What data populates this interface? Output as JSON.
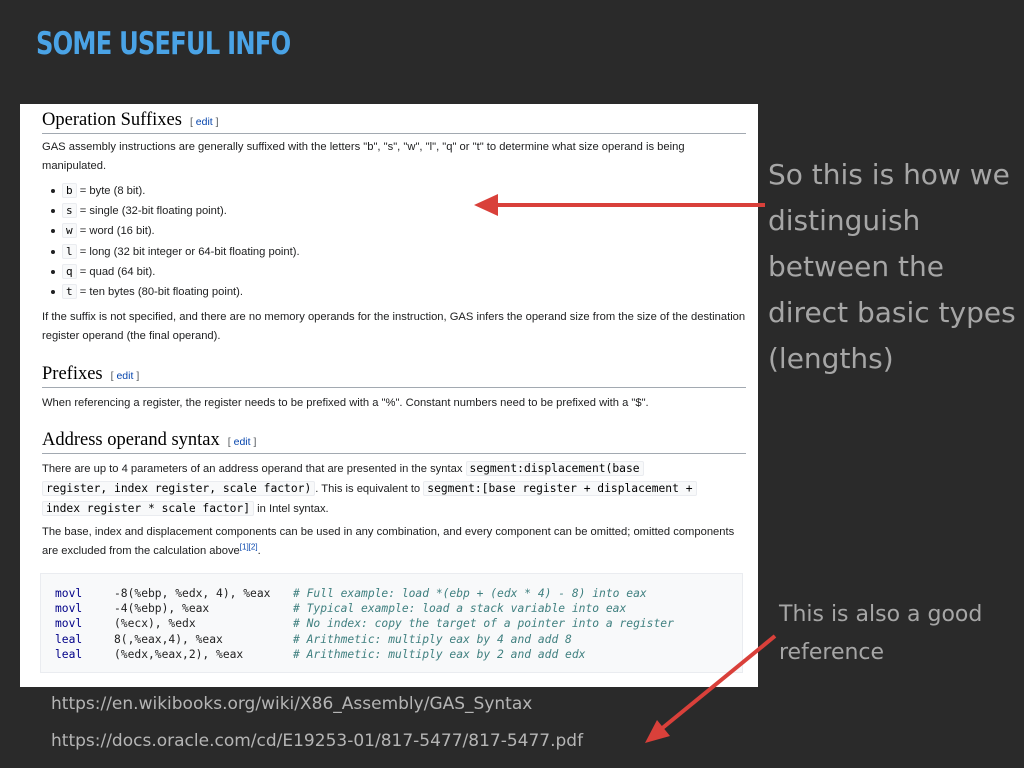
{
  "slide": {
    "title": "SOME USEFUL INFO",
    "note_main": "So this is how we distinguish between the direct basic types (lengths)",
    "note_reference": "This is also a good reference",
    "urls": [
      "https://en.wikibooks.org/wiki/X86_Assembly/GAS_Syntax",
      "https://docs.oracle.com/cd/E19253-01/817-5477/817-5477.pdf"
    ],
    "accent_color": "#4aa3e6",
    "arrow_color": "#d9403a"
  },
  "wiki": {
    "edit_label": "edit",
    "suffixes": {
      "heading": "Operation Suffixes",
      "intro": "GAS assembly instructions are generally suffixed with the letters \"b\", \"s\", \"w\", \"l\", \"q\" or \"t\" to determine what size operand is being manipulated.",
      "items": [
        {
          "code": "b",
          "text": " = byte (8 bit)."
        },
        {
          "code": "s",
          "text": " = single (32-bit floating point)."
        },
        {
          "code": "w",
          "text": " = word (16 bit)."
        },
        {
          "code": "l",
          "text": " = long (32 bit integer or 64-bit floating point)."
        },
        {
          "code": "q",
          "text": " = quad (64 bit)."
        },
        {
          "code": "t",
          "text": " = ten bytes (80-bit floating point)."
        }
      ],
      "outro": "If the suffix is not specified, and there are no memory operands for the instruction, GAS infers the operand size from the size of the destination register operand (the final operand)."
    },
    "prefixes": {
      "heading": "Prefixes",
      "text": "When referencing a register, the register needs to be prefixed with a \"%\". Constant numbers need to be prefixed with a \"$\"."
    },
    "address": {
      "heading": "Address operand syntax",
      "p1_a": "There are up to 4 parameters of an address operand that are presented in the syntax ",
      "p1_code1a": "segment:displacement(base",
      "p1_code1b": "register, index register, scale factor)",
      "p1_b": ". This is equivalent to ",
      "p1_code2a": "segment:[base register + displacement +",
      "p1_code2b": "index register * scale factor]",
      "p1_c": " in Intel syntax.",
      "p2": "The base, index and displacement components can be used in any combination, and every component can be omitted; omitted components are excluded from the calculation above",
      "p2_refs": "[1][2]",
      "p2_end": "."
    },
    "code_lines": [
      {
        "op": "movl",
        "args": "-8(%ebp, %edx, 4), %eax",
        "comment": "# Full example: load *(ebp + (edx * 4) - 8) into eax"
      },
      {
        "op": "movl",
        "args": "-4(%ebp), %eax",
        "comment": "# Typical example: load a stack variable into eax"
      },
      {
        "op": "movl",
        "args": "(%ecx), %edx",
        "comment": "# No index: copy the target of a pointer into a register"
      },
      {
        "op": "leal",
        "args": "8(,%eax,4), %eax",
        "comment": "# Arithmetic: multiply eax by 4 and add 8"
      },
      {
        "op": "leal",
        "args": "(%edx,%eax,2), %eax",
        "comment": "# Arithmetic: multiply eax by 2 and add edx"
      }
    ]
  }
}
